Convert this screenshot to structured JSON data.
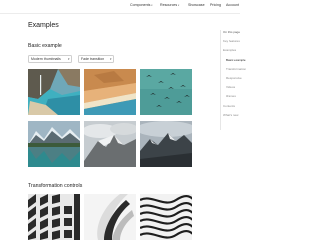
{
  "topnav": {
    "items": [
      {
        "label": "Components",
        "dropdown": true
      },
      {
        "label": "Resources",
        "dropdown": true
      },
      {
        "label": "Showcase",
        "dropdown": false
      },
      {
        "label": "Pricing",
        "dropdown": false
      },
      {
        "label": "Account",
        "dropdown": false
      }
    ]
  },
  "page": {
    "title": "Examples"
  },
  "basic_example": {
    "title": "Basic example",
    "thumbnails_select": {
      "value": "Modern thumbnails"
    },
    "transition_select": {
      "value": "Fade transition"
    },
    "images": [
      {
        "subject": "coastal cove with waterfall and turquoise water"
      },
      {
        "subject": "aerial desert dunes and blue sea"
      },
      {
        "subject": "birds flying over teal water"
      },
      {
        "subject": "mountain lake reflecting snowy peaks"
      },
      {
        "subject": "snowy mountain with clouds"
      },
      {
        "subject": "dark mountain range under cloudy sky"
      }
    ]
  },
  "transformation_controls": {
    "title": "Transformation controls",
    "images": [
      {
        "subject": "black and white geometric building facade"
      },
      {
        "subject": "white sculptural spiral architecture"
      },
      {
        "subject": "abstract wavy black and white stripes"
      }
    ]
  },
  "toc": {
    "heading": "On this page",
    "items": [
      {
        "label": "Key features",
        "level": 1
      },
      {
        "label": "Examples",
        "level": 1
      },
      {
        "label": "Basic example",
        "level": 2,
        "active": true
      },
      {
        "label": "Transformation",
        "level": 2
      },
      {
        "label": "Responsive",
        "level": 2
      },
      {
        "label": "Videos",
        "level": 2
      },
      {
        "label": "iframes",
        "level": 2
      },
      {
        "label": "Contents",
        "level": 1
      },
      {
        "label": "What's new",
        "level": 1
      }
    ]
  },
  "icons": {
    "dropdown": "chevron-down-icon"
  }
}
